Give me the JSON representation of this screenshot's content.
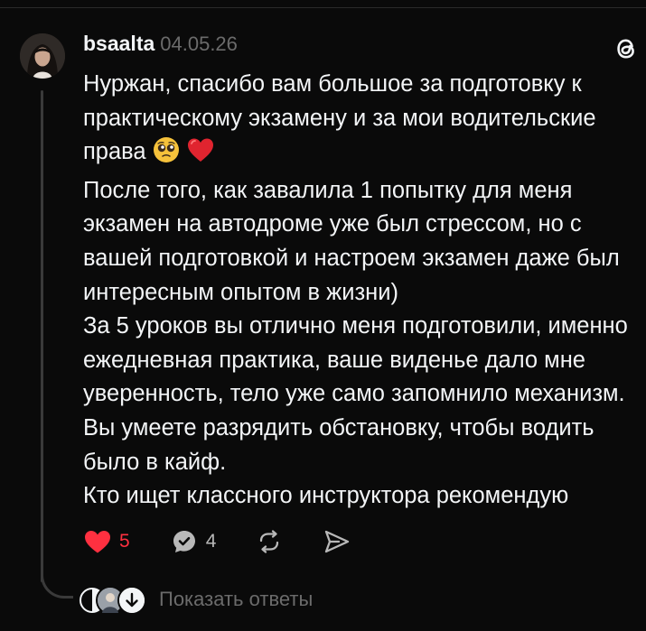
{
  "post": {
    "username": "bsaalta",
    "date": "04.05.26",
    "app_logo_icon": "threads-logo-icon",
    "paragraphs": [
      "Нуржан, спасибо вам большое за подготовку к практическому экзамену и за мои водительские права",
      "После того, как завалила 1 попытку для меня экзамен на автодроме уже был стрессом, но с вашей подготовкой и настроем экзамен даже был интересным опытом в жизни)",
      "За 5 уроков вы отлично меня подготовили, именно ежедневная практика, ваше виденье дало мне уверенность, тело уже само запомнило механизм. Вы умеете разрядить обстановку, чтобы водить было в кайф.",
      "Кто ищет классного инструктора рекомендую"
    ],
    "emojis": [
      "pleading-face-emoji",
      "red-heart-emoji"
    ]
  },
  "actions": {
    "like_count": "5",
    "reply_count": "4",
    "like_icon": "heart-filled-icon",
    "reply_icon": "speech-bubble-check-icon",
    "repost_icon": "repost-icon",
    "share_icon": "send-icon"
  },
  "replies": {
    "label": "Показать ответы"
  },
  "colors": {
    "background": "#0a0a0a",
    "text": "#f3f5f7",
    "muted": "#6b6b6b",
    "like": "#ff3040"
  }
}
